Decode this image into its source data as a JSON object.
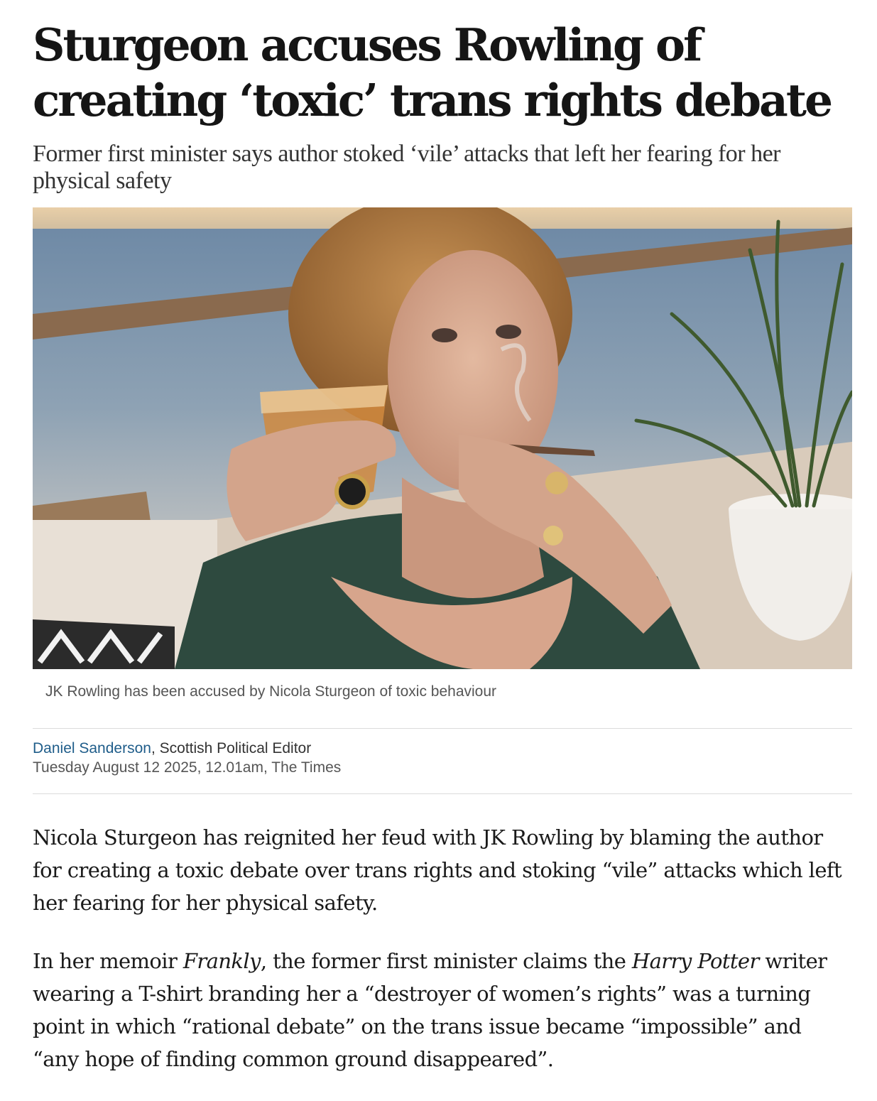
{
  "headline": "Sturgeon accuses Rowling of creating ‘toxic’ trans rights debate",
  "standfirst": "Former first minister says author stoked ‘vile’ attacks that left her fearing for her physical safety",
  "image": {
    "caption": "JK Rowling has been accused by Nicola Sturgeon of toxic behaviour"
  },
  "byline": {
    "author": "Daniel Sanderson",
    "separator": ",",
    "role": "Scottish Political Editor",
    "date": "Tuesday August 12 2025, 12.01am, The Times"
  },
  "body": {
    "p1": "Nicola Sturgeon has reignited her feud with JK Rowling by blaming the author for creating a toxic debate over trans rights and stoking “vile” attacks which left her fearing for her physical safety.",
    "p2": {
      "t1": "In her memoir ",
      "em1": "Frankly",
      "t2": ", the former first minister claims the ",
      "em2": "Harry Potter",
      "t3": " writer wearing a T-shirt branding her a “destroyer of women’s rights” was a turning point in which “rational debate” on the trans issue became “impossible” and “any hope of finding common ground disappeared”."
    }
  },
  "colors": {
    "link": "#1f5d8a",
    "rule": "#dcdcdc",
    "text": "#1a1a1a"
  }
}
